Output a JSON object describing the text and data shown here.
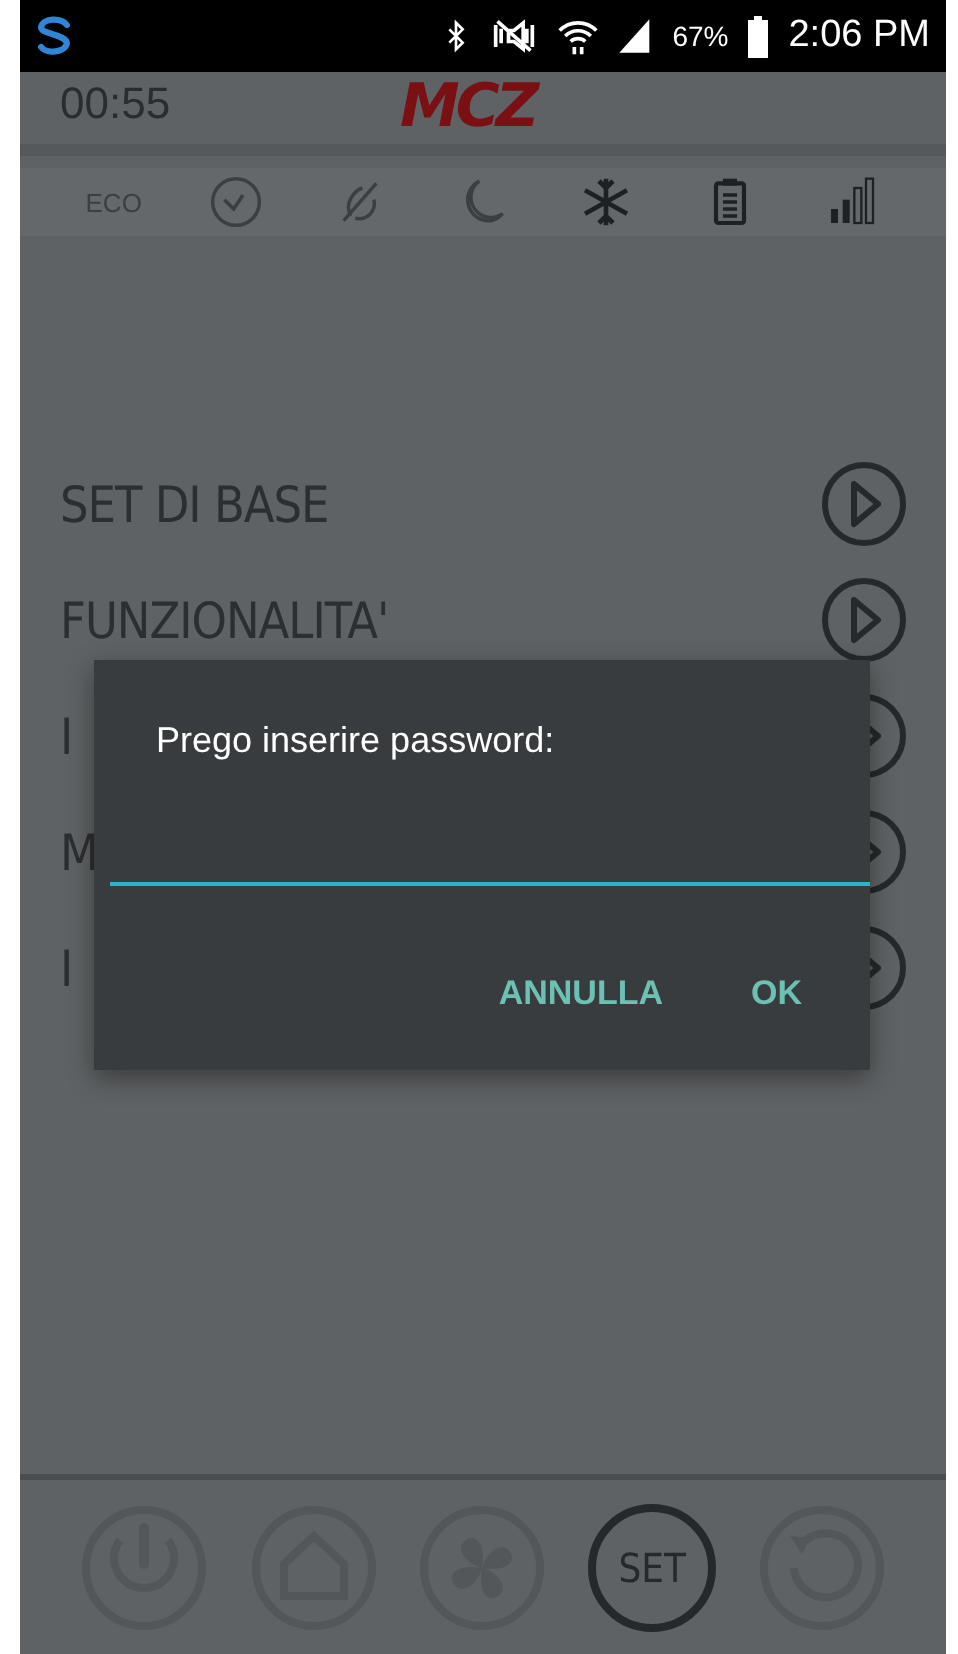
{
  "status_bar": {
    "time": "2:06 PM",
    "battery": "67%"
  },
  "header": {
    "clock": "00:55",
    "logo": "MCZ"
  },
  "feature_icons": [
    {
      "kind": "eco",
      "label": "ECO",
      "on": false
    },
    {
      "kind": "clock",
      "on": false
    },
    {
      "kind": "fan-off",
      "on": false
    },
    {
      "kind": "moon",
      "on": false
    },
    {
      "kind": "snowflake",
      "on": true
    },
    {
      "kind": "clipboard",
      "on": true
    },
    {
      "kind": "bars",
      "on": true
    }
  ],
  "menu": [
    {
      "label": "SET DI BASE"
    },
    {
      "label": "FUNZIONALITA'"
    },
    {
      "label": "I"
    },
    {
      "label": "M"
    },
    {
      "label": "I"
    }
  ],
  "dialog": {
    "title": "Prego inserire password:",
    "field": {
      "focused": true
    },
    "buttons": [
      "ANNULLA",
      "OK"
    ]
  },
  "bottom_nav": [
    {
      "kind": "power",
      "selected": false
    },
    {
      "kind": "home",
      "selected": false
    },
    {
      "kind": "fan",
      "selected": false
    },
    {
      "kind": "text",
      "label": "SET",
      "selected": true
    },
    {
      "kind": "reset",
      "selected": false
    }
  ]
}
